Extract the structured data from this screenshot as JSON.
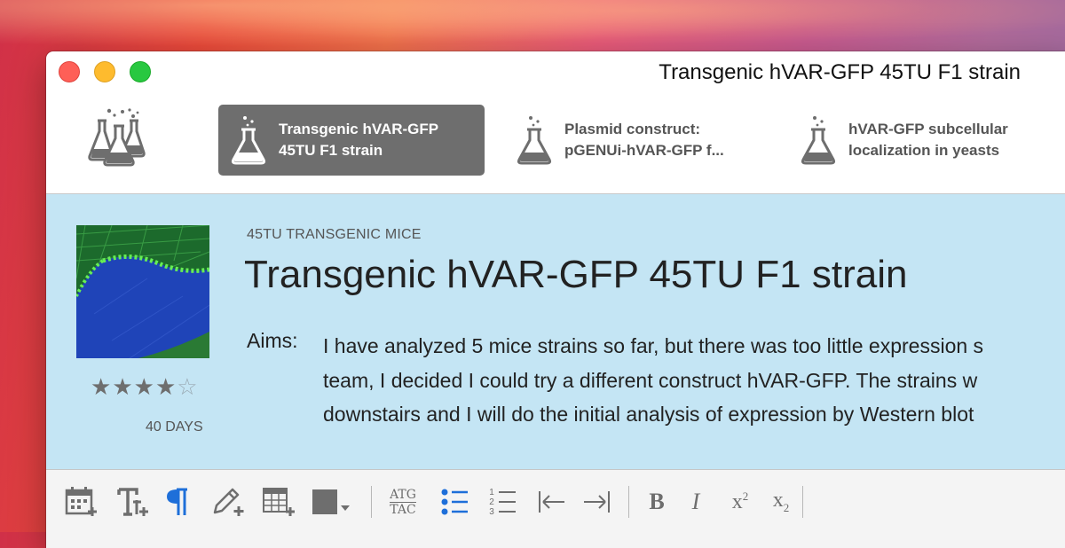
{
  "window": {
    "title": "Transgenic hVAR-GFP 45TU F1 strain"
  },
  "tabs": [
    {
      "line1": "Transgenic hVAR-GFP",
      "line2": "45TU F1 strain",
      "active": true
    },
    {
      "line1": "Plasmid construct:",
      "line2": "pGENUi-hVAR-GFP f...",
      "active": false
    },
    {
      "line1": "hVAR-GFP subcellular",
      "line2": "localization in yeasts",
      "active": false
    }
  ],
  "project": {
    "category": "45TU TRANSGENIC MICE",
    "title": "Transgenic hVAR-GFP 45TU F1 strain",
    "rating": 4,
    "rating_max": 5,
    "duration": "40 DAYS",
    "aims_label": "Aims:",
    "aims_lines": [
      "I have analyzed 5 mice strains so far, but there was too little expression s",
      "team, I decided I could try a different construct hVAR-GFP. The strains w",
      "downstairs and I will do the initial analysis of expression by Western blot"
    ]
  },
  "toolbar": {
    "dna_top": "ATG",
    "dna_bottom": "TAC",
    "bold": "B",
    "italic": "I",
    "superscript_base": "x",
    "superscript_exp": "2",
    "subscript_base": "x",
    "subscript_exp": "2",
    "numbered": [
      "1",
      "2",
      "3"
    ]
  },
  "icons": [
    "flasks-icon",
    "flask-icon",
    "calendar-add-icon",
    "text-add-icon",
    "paragraph-icon",
    "pencil-add-icon",
    "table-add-icon",
    "color-swatch-icon",
    "dna-sequence-icon",
    "bullet-list-icon",
    "numbered-list-icon",
    "outdent-icon",
    "indent-icon",
    "bold-icon",
    "italic-icon",
    "superscript-icon",
    "subscript-icon"
  ],
  "colors": {
    "active_tab": "#6e6e6e",
    "content_bg": "#c4e5f4",
    "accent_blue": "#1e6fd9",
    "icon_gray": "#6e6e6e"
  }
}
